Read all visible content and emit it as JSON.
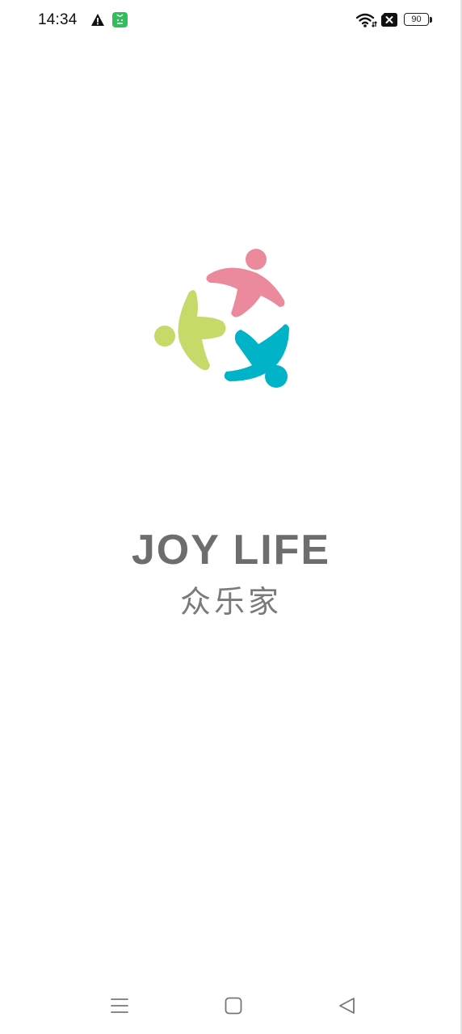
{
  "status_bar": {
    "time": "14:34",
    "battery_level": "90",
    "icons": [
      "warning-icon",
      "app-notification-icon",
      "wifi-icon",
      "no-sim-icon",
      "battery-icon"
    ]
  },
  "splash": {
    "logo_icon": "joy-life-people-logo",
    "brand_en": "JOY LIFE",
    "brand_cn": "众乐家",
    "colors": {
      "pink": "#EB8A9C",
      "green": "#C6DA6A",
      "teal": "#00B3C7",
      "text": "#6D6D6D"
    }
  },
  "nav_bar": {
    "icons": [
      "menu-icon",
      "home-icon",
      "back-icon"
    ]
  }
}
